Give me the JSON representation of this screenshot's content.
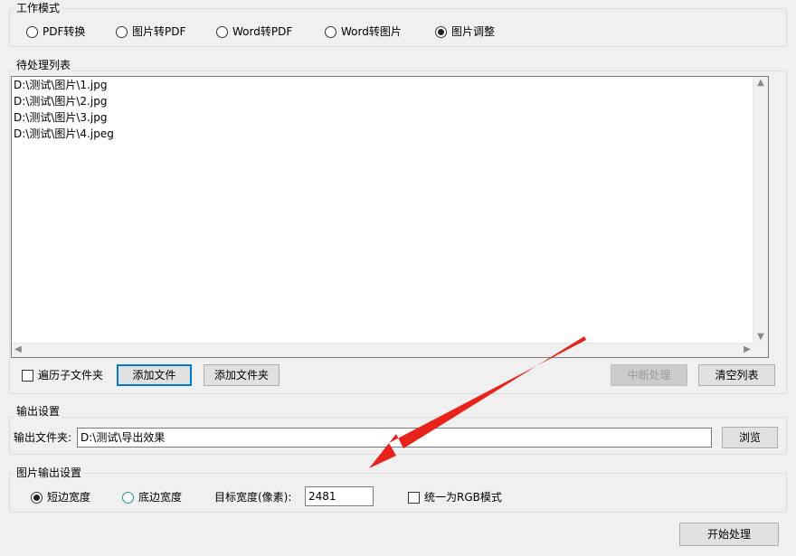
{
  "work_mode": {
    "title": "工作模式",
    "options": [
      {
        "label": "PDF转换",
        "checked": false
      },
      {
        "label": "图片转PDF",
        "checked": false
      },
      {
        "label": "Word转PDF",
        "checked": false
      },
      {
        "label": "Word转图片",
        "checked": false
      },
      {
        "label": "图片调整",
        "checked": true
      }
    ]
  },
  "pending_list": {
    "title": "待处理列表",
    "items": [
      "D:\\测试\\图片\\1.jpg",
      "D:\\测试\\图片\\2.jpg",
      "D:\\测试\\图片\\3.jpg",
      "D:\\测试\\图片\\4.jpeg"
    ],
    "traverse_subfolders_label": "遍历子文件夹",
    "add_file_label": "添加文件",
    "add_folder_label": "添加文件夹",
    "interrupt_label": "中断处理",
    "clear_list_label": "清空列表"
  },
  "output_settings": {
    "title": "输出设置",
    "folder_label": "输出文件夹:",
    "folder_value": "D:\\测试\\导出效果",
    "browse_label": "浏览"
  },
  "image_output": {
    "title": "图片输出设置",
    "short_edge_label": "短边宽度",
    "long_edge_label": "底边宽度",
    "target_width_label": "目标宽度(像素):",
    "target_width_value": "2481",
    "rgb_label": "统一为RGB模式"
  },
  "start_label": "开始处理",
  "colors": {
    "arrow": "#e8231c",
    "focus": "#0078d7"
  }
}
